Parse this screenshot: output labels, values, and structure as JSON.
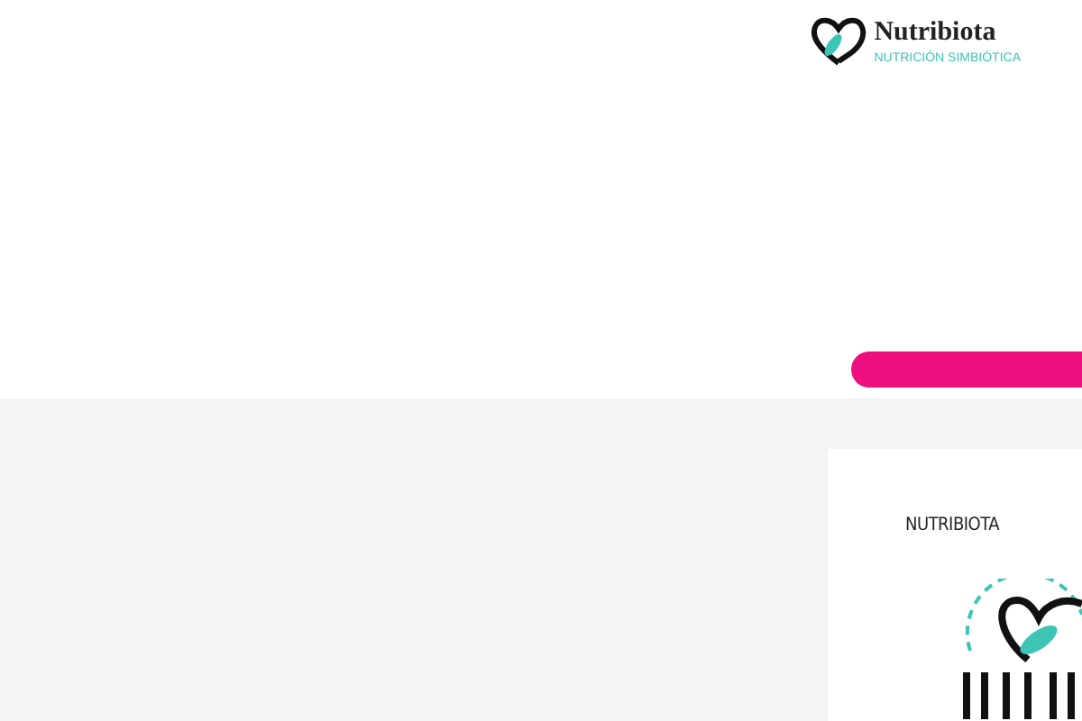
{
  "header": {
    "brand": "Nutribiota",
    "tagline": "NUTRICIÓN SIMBIÓTICA"
  },
  "sidebar_card": {
    "title": "NUTRIBIOTA"
  }
}
